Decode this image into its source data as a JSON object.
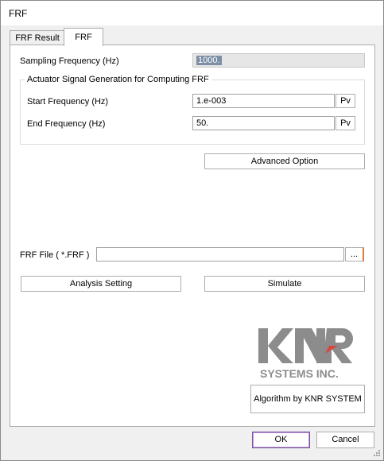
{
  "window": {
    "title": "FRF"
  },
  "tabs": [
    {
      "label": "FRF Result",
      "active": false
    },
    {
      "label": "FRF",
      "active": true
    }
  ],
  "sampling": {
    "label": "Sampling Frequency (Hz)",
    "value": "1000."
  },
  "actuator_group": {
    "title": "Actuator Signal Generation for Computing FRF",
    "start": {
      "label": "Start Frequency (Hz)",
      "value": "1.e-003",
      "pv_label": "Pv"
    },
    "end": {
      "label": "End Frequency (Hz)",
      "value": "50.",
      "pv_label": "Pv"
    }
  },
  "advanced_option_label": "Advanced Option",
  "frf_file": {
    "label": "FRF File ( *.FRF )",
    "value": "",
    "browse_label": "..."
  },
  "analysis_setting_label": "Analysis Setting",
  "simulate_label": "Simulate",
  "logo": {
    "text": "KNR",
    "subtext": "SYSTEMS INC."
  },
  "algorithm_button_label": "Algorithm by KNR SYSTEM",
  "footer": {
    "ok_label": "OK",
    "cancel_label": "Cancel"
  },
  "colors": {
    "logo_gray": "#8c8c8c",
    "logo_red": "#d9463c",
    "ok_border": "#7a4fa0"
  }
}
